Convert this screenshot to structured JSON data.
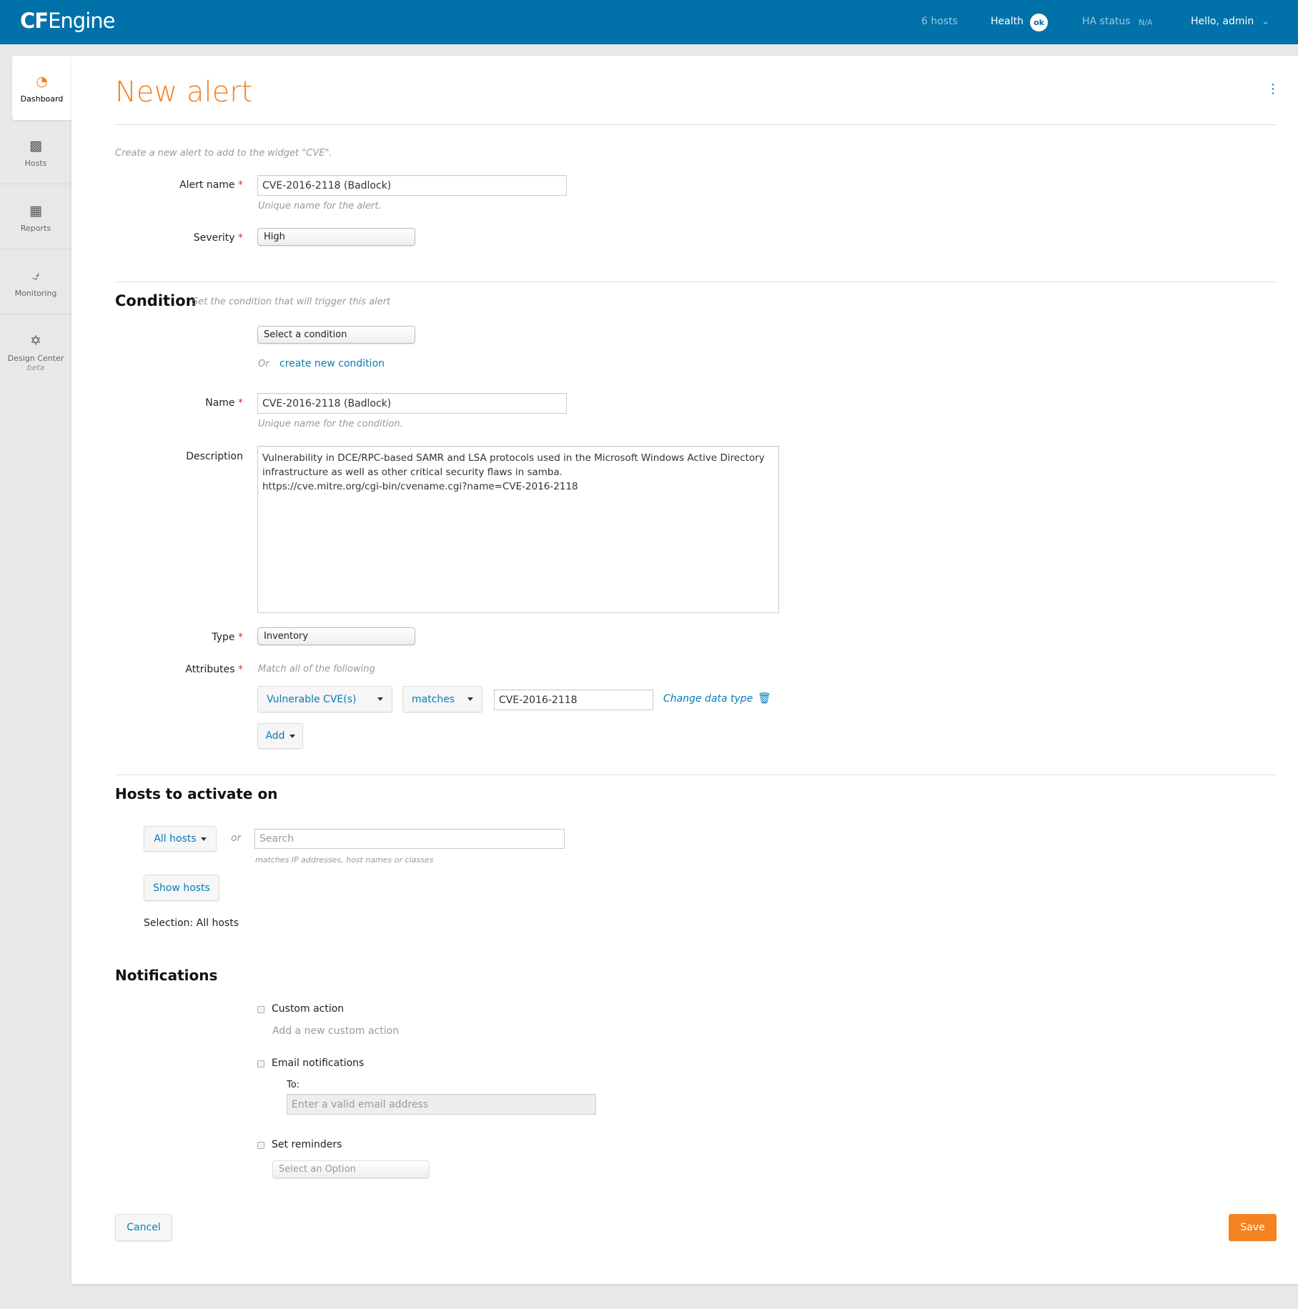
{
  "header": {
    "logo": "CFEngine",
    "logo_bold": "CF",
    "logo_rest": "Engine",
    "hosts_count": "6 hosts",
    "health_label": "Health",
    "health_status": "ok",
    "ha_label": "HA status",
    "ha_value": "N/A",
    "user_menu": "Hello, admin"
  },
  "sidebar": {
    "items": [
      {
        "label": "Dashboard",
        "icon": "dashboard-gauge-icon",
        "active": true
      },
      {
        "label": "Hosts",
        "icon": "sitemap-icon"
      },
      {
        "label": "Reports",
        "icon": "table-icon"
      },
      {
        "label": "Monitoring",
        "icon": "stethoscope-icon"
      },
      {
        "label": "Design Center",
        "sub": "beta",
        "icon": "puzzle-icon"
      }
    ]
  },
  "page": {
    "title": "New alert",
    "intro": "Create a new alert to add to the widget \"CVE\"."
  },
  "alert": {
    "name_label": "Alert name",
    "name_value": "CVE-2016-2118 (Badlock)",
    "name_help": "Unique name for the alert.",
    "severity_label": "Severity",
    "severity_value": "High"
  },
  "condition": {
    "heading": "Condition",
    "subheading": "Set the condition that will trigger this alert",
    "select_placeholder": "Select a condition",
    "or": "Or",
    "create_link": "create new condition",
    "name_label": "Name",
    "name_value": "CVE-2016-2118 (Badlock)",
    "name_help": "Unique name for the condition.",
    "description_label": "Description",
    "description_value": "Vulnerability in DCE/RPC-based SAMR and LSA protocols used in the Microsoft Windows Active Directory infrastructure as well as other critical security flaws in samba.\nhttps://cve.mitre.org/cgi-bin/cvename.cgi?name=CVE-2016-2118",
    "type_label": "Type",
    "type_value": "Inventory",
    "attributes_label": "Attributes",
    "attributes_help": "Match all of the following",
    "attribute": {
      "field": "Vulnerable CVE(s)",
      "operator": "matches",
      "value": "CVE-2016-2118",
      "change_type": "Change data type"
    },
    "add_label": "Add"
  },
  "hosts": {
    "heading": "Hosts to activate on",
    "all_hosts": "All hosts",
    "or": "or",
    "search_placeholder": "Search",
    "search_help": "matches IP addresses, host names or classes",
    "show_hosts": "Show hosts",
    "selection": "Selection: All hosts"
  },
  "notifications": {
    "heading": "Notifications",
    "custom_action": "Custom action",
    "custom_action_link": "Add a new custom action",
    "email": "Email notifications",
    "to_label": "To:",
    "email_placeholder": "Enter a valid email address",
    "reminders": "Set reminders",
    "reminders_placeholder": "Select an Option"
  },
  "footer": {
    "cancel": "Cancel",
    "save": "Save"
  },
  "colors": {
    "header": "#0071a9",
    "accent": "#f58220",
    "link": "#0a7ab8",
    "required": "#e0302b"
  }
}
